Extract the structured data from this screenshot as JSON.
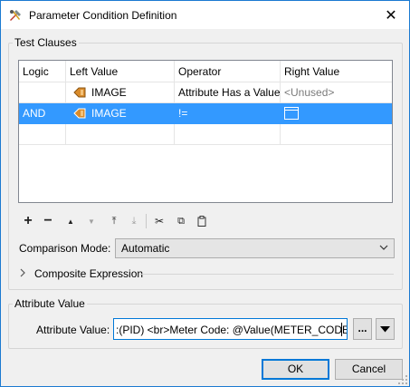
{
  "window": {
    "title": "Parameter Condition Definition",
    "close_glyph": "✕",
    "app_icon": "tools-icon"
  },
  "test_clauses": {
    "legend": "Test Clauses",
    "columns": [
      "Logic",
      "Left Value",
      "Operator",
      "Right Value"
    ],
    "rows": [
      {
        "logic": "",
        "left_value": "IMAGE",
        "left_icon": "attribute-icon",
        "operator": "Attribute Has a Value",
        "right_value": "<Unused>",
        "selected": false
      },
      {
        "logic": "AND",
        "left_value": "IMAGE",
        "left_icon": "attribute-icon",
        "operator": "!=",
        "right_value": "",
        "right_icon": "text-editor-icon",
        "selected": true
      }
    ]
  },
  "toolbar": {
    "buttons": [
      {
        "name": "add-row-button",
        "glyph": "+",
        "enabled": true
      },
      {
        "name": "remove-row-button",
        "glyph": "−",
        "enabled": true
      },
      {
        "name": "move-up-button",
        "glyph": "▲",
        "enabled": true
      },
      {
        "name": "move-down-button",
        "glyph": "▼",
        "enabled": false
      },
      {
        "name": "move-top-button",
        "glyph": "⤒",
        "enabled": true
      },
      {
        "name": "move-bottom-button",
        "glyph": "⤓",
        "enabled": false
      },
      {
        "name": "cut-button",
        "glyph": "✂",
        "enabled": true
      },
      {
        "name": "copy-button",
        "glyph": "⧉",
        "enabled": true
      },
      {
        "name": "paste-button",
        "glyph": "📋",
        "enabled": true
      }
    ]
  },
  "comparison_mode": {
    "label": "Comparison Mode:",
    "value": "Automatic"
  },
  "composite_expression": {
    "label": "Composite Expression"
  },
  "attribute_value": {
    "legend": "Attribute Value",
    "label": "Attribute Value:",
    "value": ":(PID) <br>Meter Code: @Value(METER_CODE)",
    "ellipsis_label": "..."
  },
  "buttons": {
    "ok": "OK",
    "cancel": "Cancel"
  },
  "colors": {
    "selection": "#3399ff",
    "focus_border": "#0078d7",
    "window_border": "#1b7ad1",
    "attribute_icon": "#d98b2b"
  }
}
